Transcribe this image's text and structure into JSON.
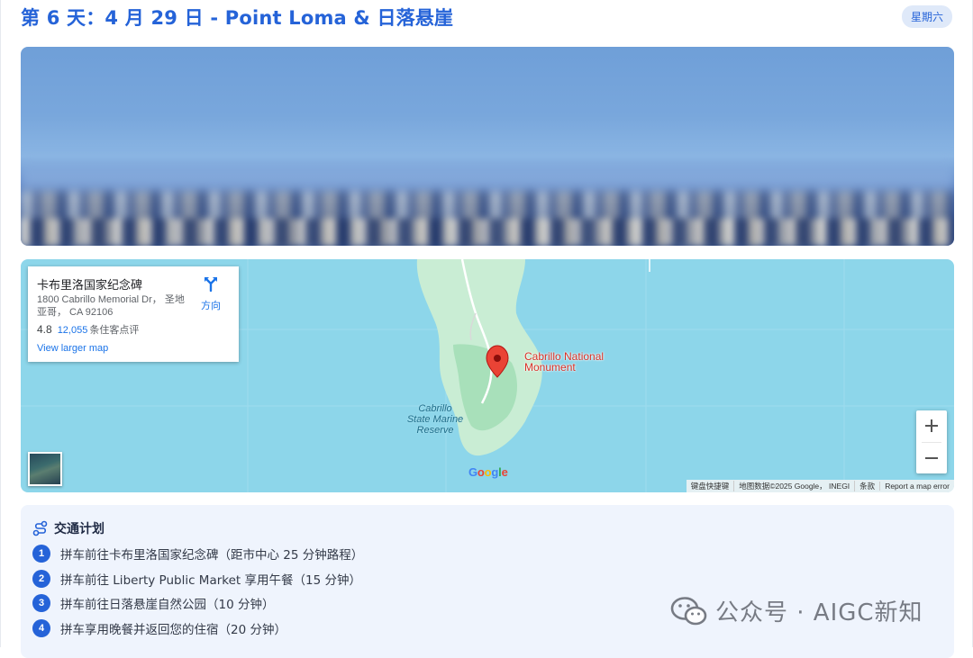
{
  "header": {
    "title": "第 6 天：4 月 29 日 - Point Loma & 日落悬崖",
    "weekday": "星期六"
  },
  "map": {
    "card": {
      "place_name": "卡布里洛国家纪念碑",
      "address": "1800 Cabrillo Memorial Dr， 圣地亚哥， CA 92106",
      "rating": "4.8",
      "review_count": "12,055",
      "review_suffix": "条住客点评",
      "larger_map": "View larger map",
      "directions": "方向"
    },
    "marker": {
      "line1": "Cabrillo National",
      "line2": "Monument"
    },
    "park_label": {
      "line1": "Cabrillo",
      "line2": "State Marine",
      "line3": "Reserve"
    },
    "logo": "Google",
    "footer": {
      "shortcuts": "键盘快捷键",
      "data": "地图数据©2025 Google， INEGI",
      "terms": "条款",
      "report": "Report a map error"
    },
    "colors": {
      "water": "#8dd6ea",
      "land": "#c9edd4",
      "marker": "#ea4335"
    }
  },
  "transport": {
    "title": "交通计划",
    "icon": "route-icon",
    "steps": [
      {
        "num": "1",
        "text": "拼车前往卡布里洛国家纪念碑（距市中心 25 分钟路程）"
      },
      {
        "num": "2",
        "text": "拼车前往 Liberty Public Market 享用午餐（15 分钟）"
      },
      {
        "num": "3",
        "text": "拼车前往日落悬崖自然公园（10 分钟）"
      },
      {
        "num": "4",
        "text": "拼车享用晚餐并返回您的住宿（20 分钟）"
      }
    ]
  },
  "watermark": {
    "text": "公众号 · AIGC新知",
    "icon": "wechat-icon"
  },
  "accent": "#2563d8"
}
